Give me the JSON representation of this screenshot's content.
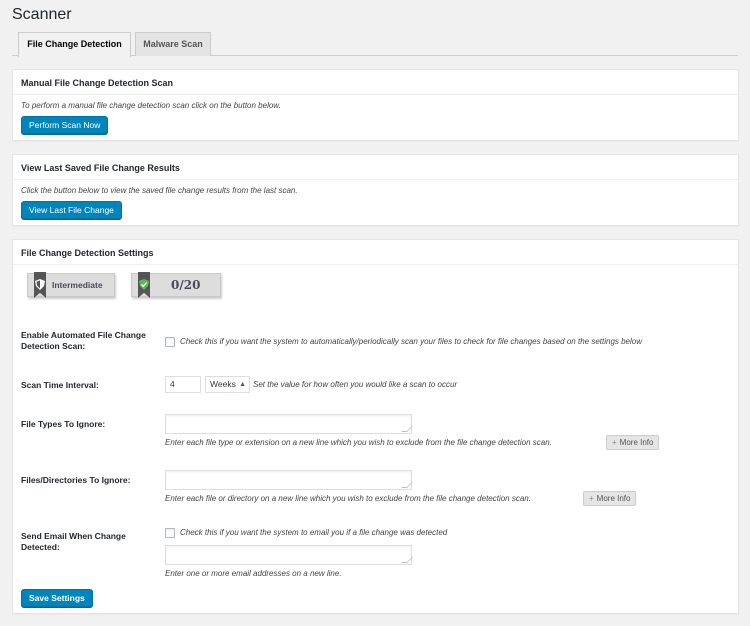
{
  "page": {
    "title": "Scanner"
  },
  "tabs": [
    {
      "label": "File Change Detection",
      "active": true
    },
    {
      "label": "Malware Scan",
      "active": false
    }
  ],
  "manual_scan": {
    "title": "Manual File Change Detection Scan",
    "description": "To perform a manual file change detection scan click on the button below.",
    "button": "Perform Scan Now"
  },
  "last_results": {
    "title": "View Last Saved File Change Results",
    "description": "Click the button below to view the saved file change results from the last scan.",
    "button": "View Last File Change"
  },
  "settings": {
    "title": "File Change Detection Settings",
    "badges": {
      "level": {
        "label": "Intermediate",
        "icon": "shield-icon"
      },
      "score": {
        "label": "0/20",
        "icon": "shield-check-icon"
      }
    },
    "automated": {
      "label": "Enable Automated File Change Detection Scan:",
      "checked": false,
      "description": "Check this if you want the system to automatically/periodically scan your files to check for file changes based on the settings below"
    },
    "interval": {
      "label": "Scan Time Interval:",
      "value": "4",
      "unit": "Weeks",
      "description": "Set the value for how often you would like a scan to occur"
    },
    "file_types": {
      "label": "File Types To Ignore:",
      "value": "",
      "description": "Enter each file type or extension on a new line which you wish to exclude from the file change detection scan.",
      "more_info": "More Info"
    },
    "files_dirs": {
      "label": "Files/Directories To Ignore:",
      "value": "",
      "description": "Enter each file or directory on a new line which you wish to exclude from the file change detection scan.",
      "more_info": "More Info"
    },
    "email": {
      "label": "Send Email When Change Detected:",
      "checked": false,
      "description": "Check this if you want the system to email you if a file change was detected",
      "addresses": "",
      "addresses_description": "Enter one or more email addresses on a new line."
    },
    "save_button": "Save Settings"
  },
  "colors": {
    "primary_button": "#0085ba",
    "background": "#f1f1f1",
    "badge_ribbon": "#555555",
    "score_icon": "#5cb85c"
  }
}
